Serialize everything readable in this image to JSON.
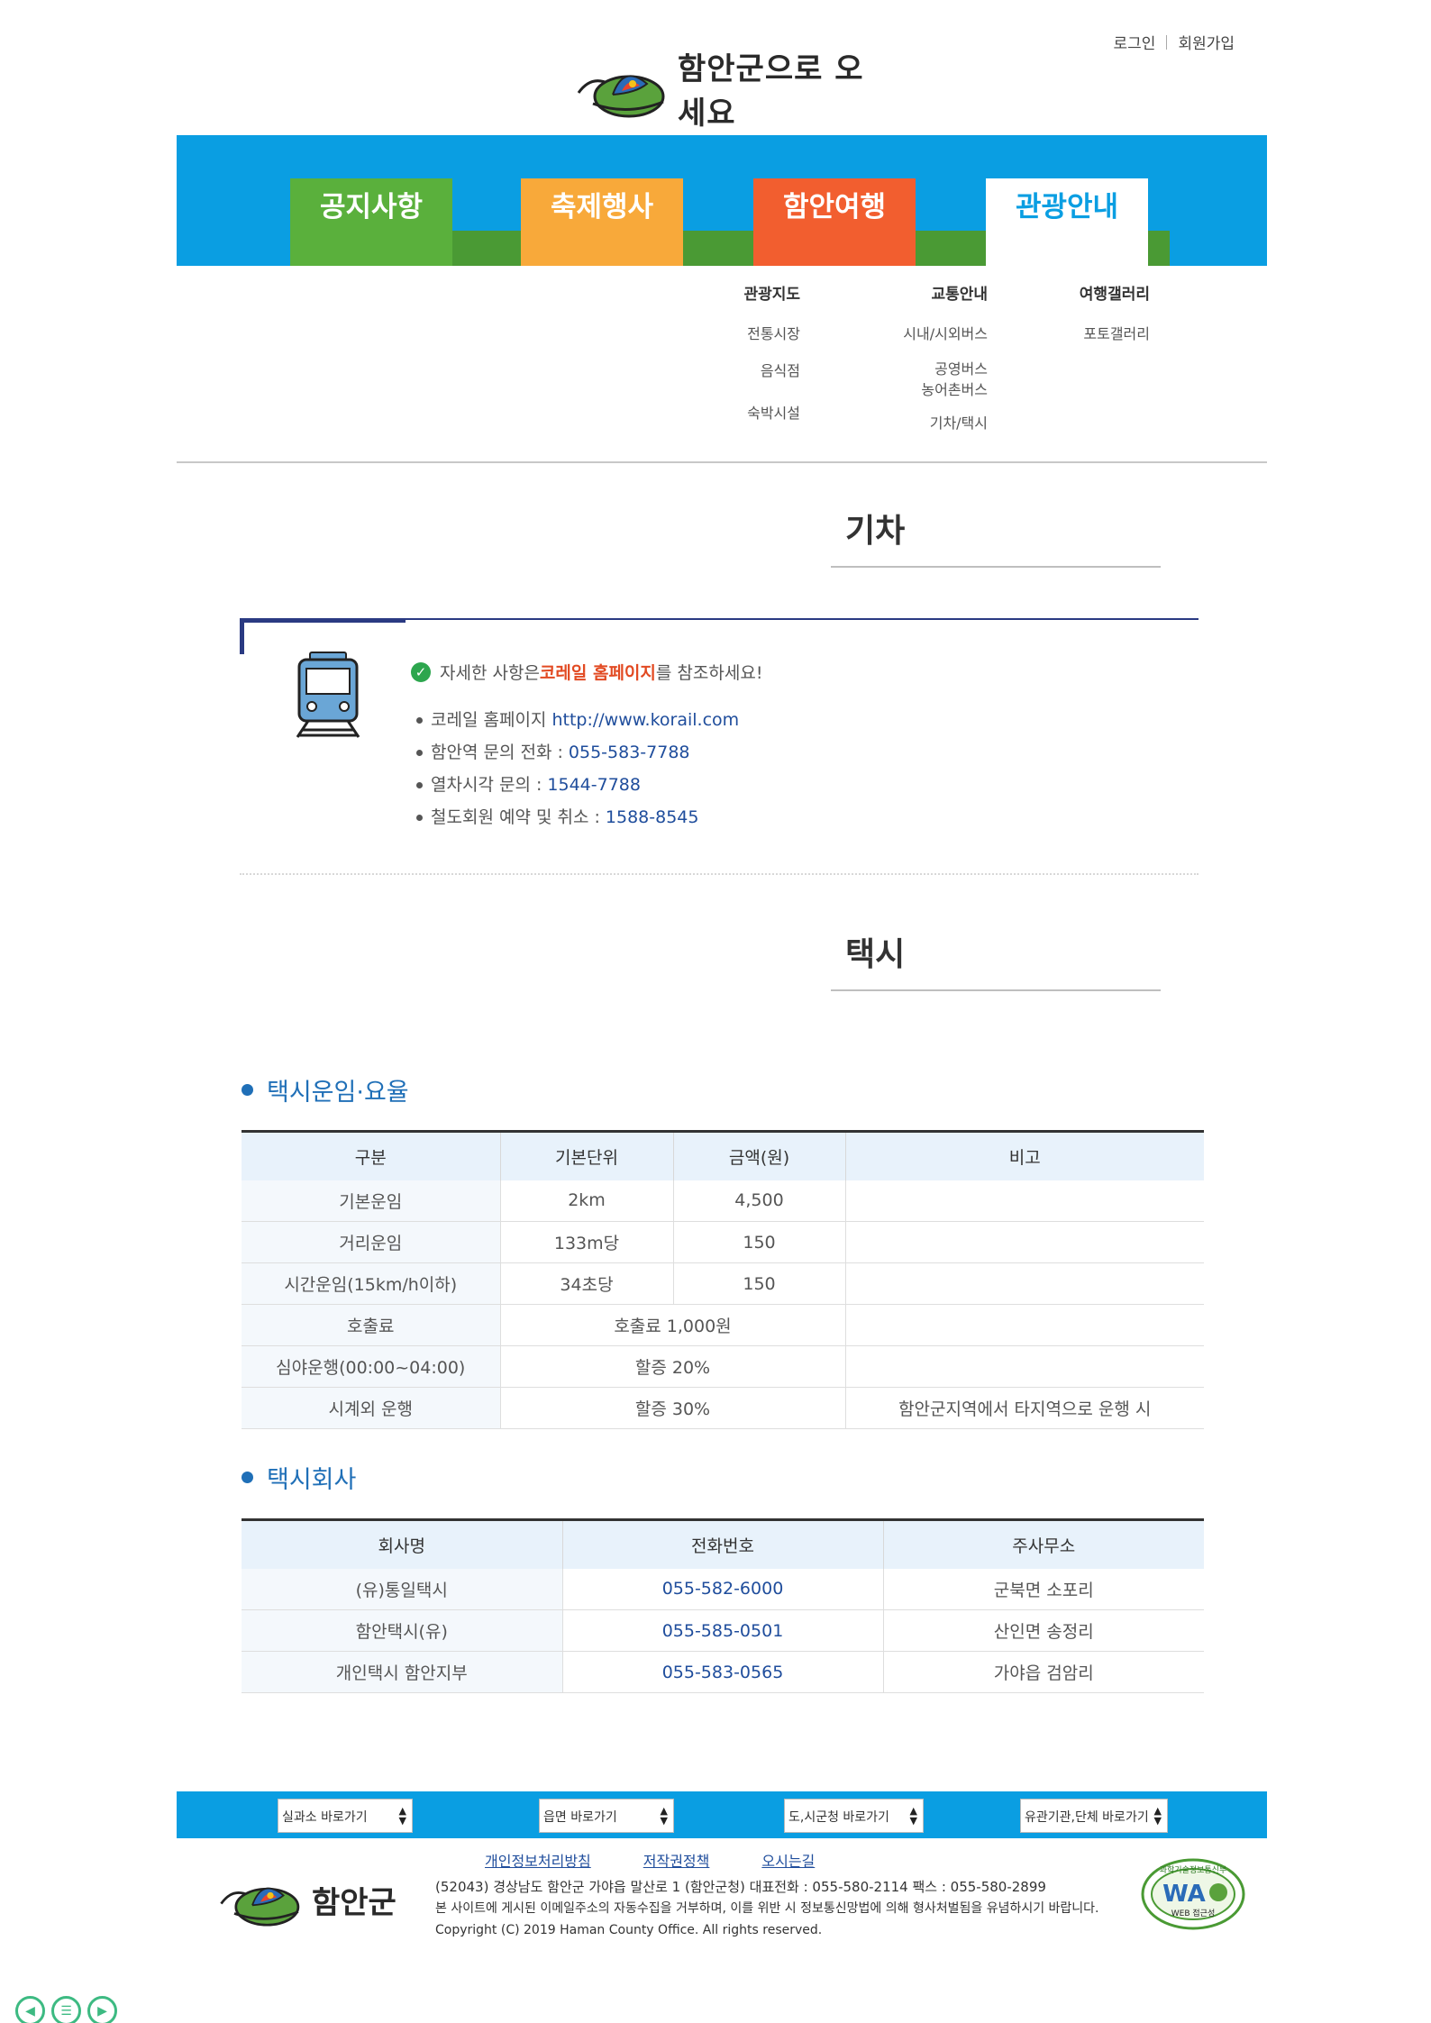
{
  "top_links": {
    "login": "로그인",
    "join": "회원가입"
  },
  "logo": {
    "text": "함안군으로 오세요"
  },
  "nav": {
    "tabs": [
      {
        "label": "공지사항",
        "color": "#5ab03c"
      },
      {
        "label": "축제행사",
        "color": "#f8a93a"
      },
      {
        "label": "함안여행",
        "color": "#f25e2f"
      },
      {
        "label": "관광안내",
        "color": "#0a9ee2"
      }
    ],
    "band_color": "#0a9ee2"
  },
  "submenu": {
    "col1": {
      "title": "관광지도",
      "items": [
        "전통시장",
        "음식점",
        "숙박시설"
      ]
    },
    "col2": {
      "title": "교통안내",
      "items": [
        "시내/시외버스",
        "공영버스",
        "농어촌버스",
        "기차/택시"
      ]
    },
    "col3": {
      "title": "여행갤러리",
      "items": [
        "포토갤러리"
      ]
    }
  },
  "train_section": {
    "title": "기차",
    "lead_prefix": "자세한 사항은 ",
    "lead_accent": "코레일 홈페이지",
    "lead_suffix": "를 참조하세요!",
    "items": [
      {
        "label": "코레일 홈페이지 ",
        "value": "http://www.korail.com"
      },
      {
        "label": "함안역 문의 전화 : ",
        "value": "055-583-7788"
      },
      {
        "label": "열차시각 문의 : ",
        "value": "1544-7788"
      },
      {
        "label": "철도회원 예약 및 취소 : ",
        "value": "1588-8545"
      }
    ]
  },
  "taxi_section": {
    "title": "택시",
    "fare_heading": "택시운임·요율",
    "fare_headers": [
      "구분",
      "기본단위",
      "금액(원)",
      "비고"
    ],
    "fare_rows": [
      [
        "기본운임",
        "2km",
        "4,500",
        ""
      ],
      [
        "거리운임",
        "133m당",
        "150",
        ""
      ],
      [
        "시간운임(15km/h이하)",
        "34초당",
        "150",
        ""
      ],
      [
        "호출료",
        "호출료 1,000원",
        "",
        ""
      ],
      [
        "심야운행(00:00~04:00)",
        "할증 20%",
        "",
        ""
      ],
      [
        "시계외 운행",
        "할증 30%",
        "",
        "함안군지역에서 타지역으로 운행 시"
      ]
    ],
    "company_heading": "택시회사",
    "company_headers": [
      "회사명",
      "전화번호",
      "주사무소"
    ],
    "company_rows": [
      [
        "(유)통일택시",
        "055-582-6000",
        "군북면 소포리"
      ],
      [
        "함안택시(유)",
        "055-585-0501",
        "산인면 송정리"
      ],
      [
        "개인택시 함안지부",
        "055-583-0565",
        "가야읍 검암리"
      ]
    ]
  },
  "footer": {
    "selects": [
      "실과소 바로가기",
      "읍면 바로가기",
      "도,시군청 바로가기",
      "유관기관,단체 바로가기"
    ],
    "links": [
      "개인정보처리방침",
      "저작권정책",
      "오시는길"
    ],
    "logo_text": "함안군",
    "address_line": "(52043) 경상남도 함안군 가야읍 말산로 1 (함안군청)    대표전화 : 055-580-2114    팩스 : 055-580-2899",
    "notice_line": "본 사이트에 게시된 이메일주소의 자동수집을 거부하며, 이를 위반 시 정보통신망법에 의해 형사처벌됨을 유념하시기 바랍니다.",
    "copyright": "Copyright (C) 2019 Haman County Office. All rights reserved.",
    "wa_text": "WA",
    "wa_caption": "WEB 접근성",
    "wa_top": "과학기술정보통신부"
  }
}
